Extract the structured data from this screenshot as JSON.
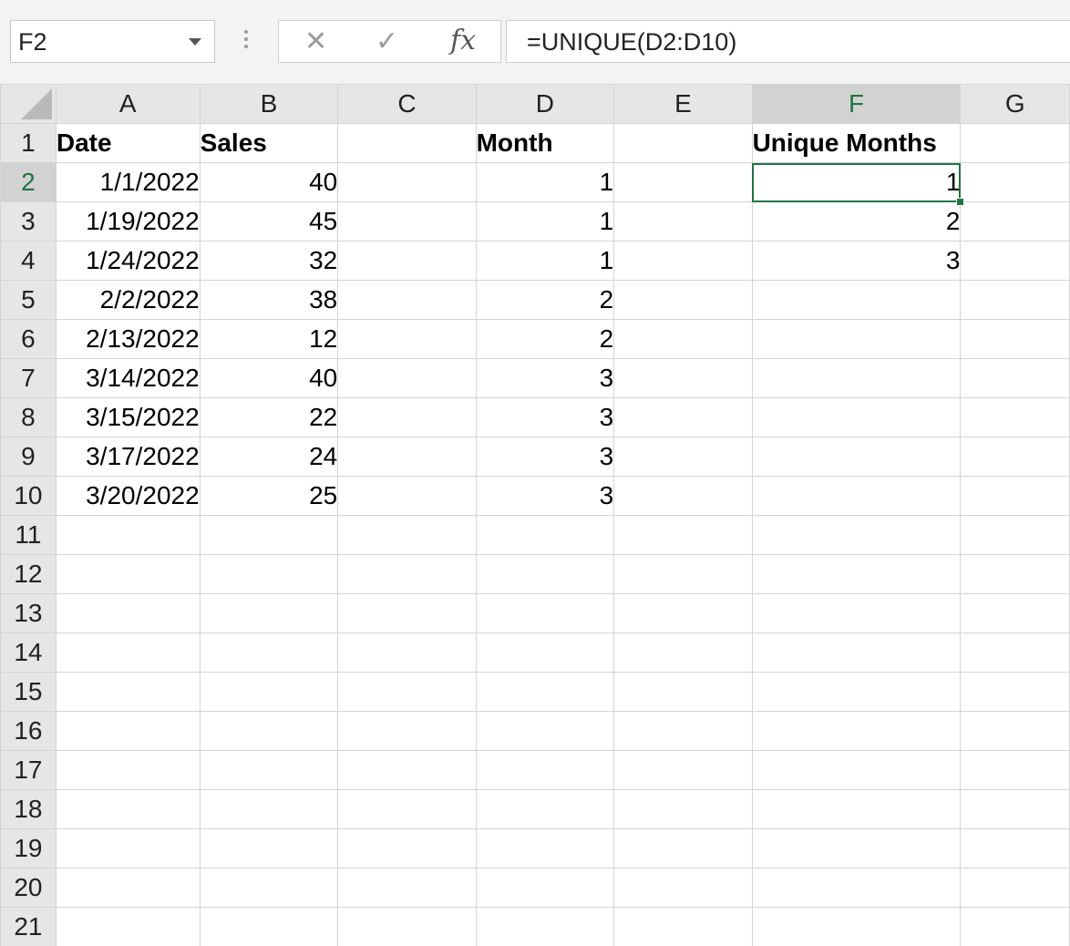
{
  "formula_bar": {
    "name_box": "F2",
    "cancel_icon": "close-icon",
    "enter_icon": "check-icon",
    "fx_label": "fx",
    "formula": "=UNIQUE(D2:D10)"
  },
  "columns": [
    "A",
    "B",
    "C",
    "D",
    "E",
    "F",
    "G"
  ],
  "rows": [
    "1",
    "2",
    "3",
    "4",
    "5",
    "6",
    "7",
    "8",
    "9",
    "10",
    "11",
    "12",
    "13",
    "14",
    "15",
    "16",
    "17",
    "18",
    "19",
    "20",
    "21"
  ],
  "active_cell": {
    "column": "F",
    "row": "2"
  },
  "cells": {
    "A1": "Date",
    "B1": "Sales",
    "D1": "Month",
    "F1": "Unique Months",
    "A2": "1/1/2022",
    "B2": "40",
    "D2": "1",
    "F2": "1",
    "A3": "1/19/2022",
    "B3": "45",
    "D3": "1",
    "F3": "2",
    "A4": "1/24/2022",
    "B4": "32",
    "D4": "1",
    "F4": "3",
    "A5": "2/2/2022",
    "B5": "38",
    "D5": "2",
    "A6": "2/13/2022",
    "B6": "12",
    "D6": "2",
    "A7": "3/14/2022",
    "B7": "40",
    "D7": "3",
    "A8": "3/15/2022",
    "B8": "22",
    "D8": "3",
    "A9": "3/17/2022",
    "B9": "24",
    "D9": "3",
    "A10": "3/20/2022",
    "B10": "25",
    "D10": "3"
  },
  "colors": {
    "accent": "#217346",
    "spill_border": "#2f6fc2"
  }
}
